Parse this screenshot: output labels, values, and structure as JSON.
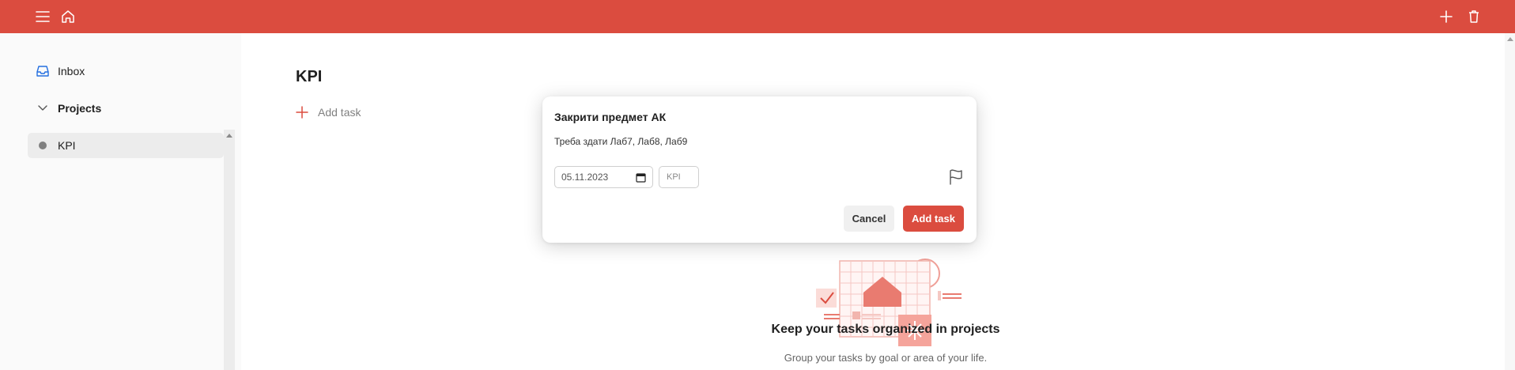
{
  "colors": {
    "accent": "#db4c3f",
    "sidebar_bg": "#fafafa",
    "selected_bg": "#ececec"
  },
  "topbar": {
    "left_icons": [
      "menu-icon",
      "home-icon"
    ],
    "right_icons": [
      "plus-icon",
      "trash-icon"
    ]
  },
  "sidebar": {
    "inbox_label": "Inbox",
    "projects_label": "Projects",
    "projects": [
      {
        "label": "KPI"
      }
    ]
  },
  "main": {
    "title": "KPI",
    "add_task_label": "Add task",
    "empty_state": {
      "title": "Keep your tasks organized in projects",
      "subtitle": "Group your tasks by goal or area of your life."
    }
  },
  "modal": {
    "task_name": "Закрити предмет АК",
    "description": "Треба здати Лаб7, Лаб8, Лаб9",
    "due_date": "05.11.2023",
    "project": "KPI",
    "cancel_label": "Cancel",
    "submit_label": "Add task"
  }
}
